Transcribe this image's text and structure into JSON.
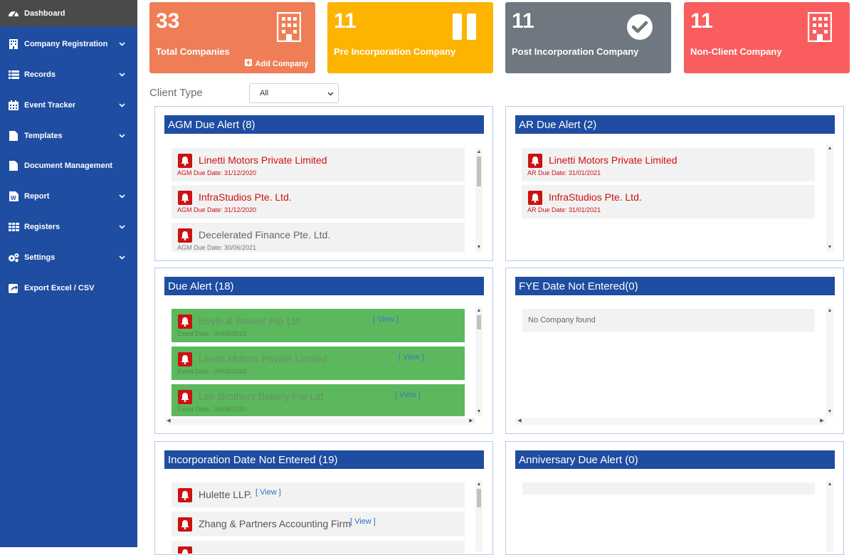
{
  "sidebar": {
    "items": [
      {
        "label": "Dashboard",
        "icon": "dashboard-icon"
      },
      {
        "label": "Company Registration",
        "icon": "building-icon"
      },
      {
        "label": "Records",
        "icon": "list-icon"
      },
      {
        "label": "Event Tracker",
        "icon": "calendar-icon"
      },
      {
        "label": "Templates",
        "icon": "file-icon"
      },
      {
        "label": "Document Management",
        "icon": "document-icon"
      },
      {
        "label": "Report",
        "icon": "word-file-icon"
      },
      {
        "label": "Registers",
        "icon": "grid-icon"
      },
      {
        "label": "Settings",
        "icon": "gears-icon"
      },
      {
        "label": "Export Excel / CSV",
        "icon": "export-icon"
      }
    ]
  },
  "cards": [
    {
      "count": "33",
      "label": "Total Companies",
      "action": "Add Company",
      "color": "#ef7e56"
    },
    {
      "count": "11",
      "label": "Pre Incorporation Company",
      "color": "#fdb400"
    },
    {
      "count": "11",
      "label": "Post Incorporation Company",
      "color": "#6f7780"
    },
    {
      "count": "11",
      "label": "Non-Client Company",
      "color": "#f95d5d"
    }
  ],
  "filter": {
    "label": "Client Type",
    "selected": "All"
  },
  "panels": {
    "agm": {
      "title": "AGM Due Alert (8)",
      "items": [
        {
          "name": "Linetti Motors Private Limited",
          "date": "AGM Due Date: 31/12/2020"
        },
        {
          "name": "InfraStudios Pte. Ltd.",
          "date": "AGM Due Date: 31/12/2020"
        },
        {
          "name": "Decelerated Finance Pte. Ltd.",
          "date": "AGM Due Date: 30/06/2021"
        }
      ]
    },
    "ar": {
      "title": "AR Due Alert (2)",
      "items": [
        {
          "name": "Linetti Motors Private Limited",
          "date": "AR Due Date: 31/01/2021"
        },
        {
          "name": "InfraStudios Pte. Ltd.",
          "date": "AR Due Date: 31/01/2021"
        }
      ]
    },
    "due": {
      "title": "Due Alert (18)",
      "view_label": "[ View ]",
      "items": [
        {
          "name": "Boyle & Bowler Pte Ltd",
          "date": "Event Date : 30/09/2015"
        },
        {
          "name": "Linetti Motors Private Limited",
          "date": "Event Date : 09/06/2020"
        },
        {
          "name": "Lee Brothers Bakery Pte Ltd",
          "date": "Event Date : 16/06/2020"
        }
      ]
    },
    "fye": {
      "title": "FYE Date Not Entered(0)",
      "empty_text": "No Company found"
    },
    "incorp": {
      "title": "Incorporation Date Not Entered (19)",
      "view_label": "[ View ]",
      "items": [
        {
          "name": "Hulette LLP."
        },
        {
          "name": "Zhang & Partners Accounting Firm"
        }
      ]
    },
    "anniv": {
      "title": "Anniversary Due Alert (0)"
    }
  }
}
